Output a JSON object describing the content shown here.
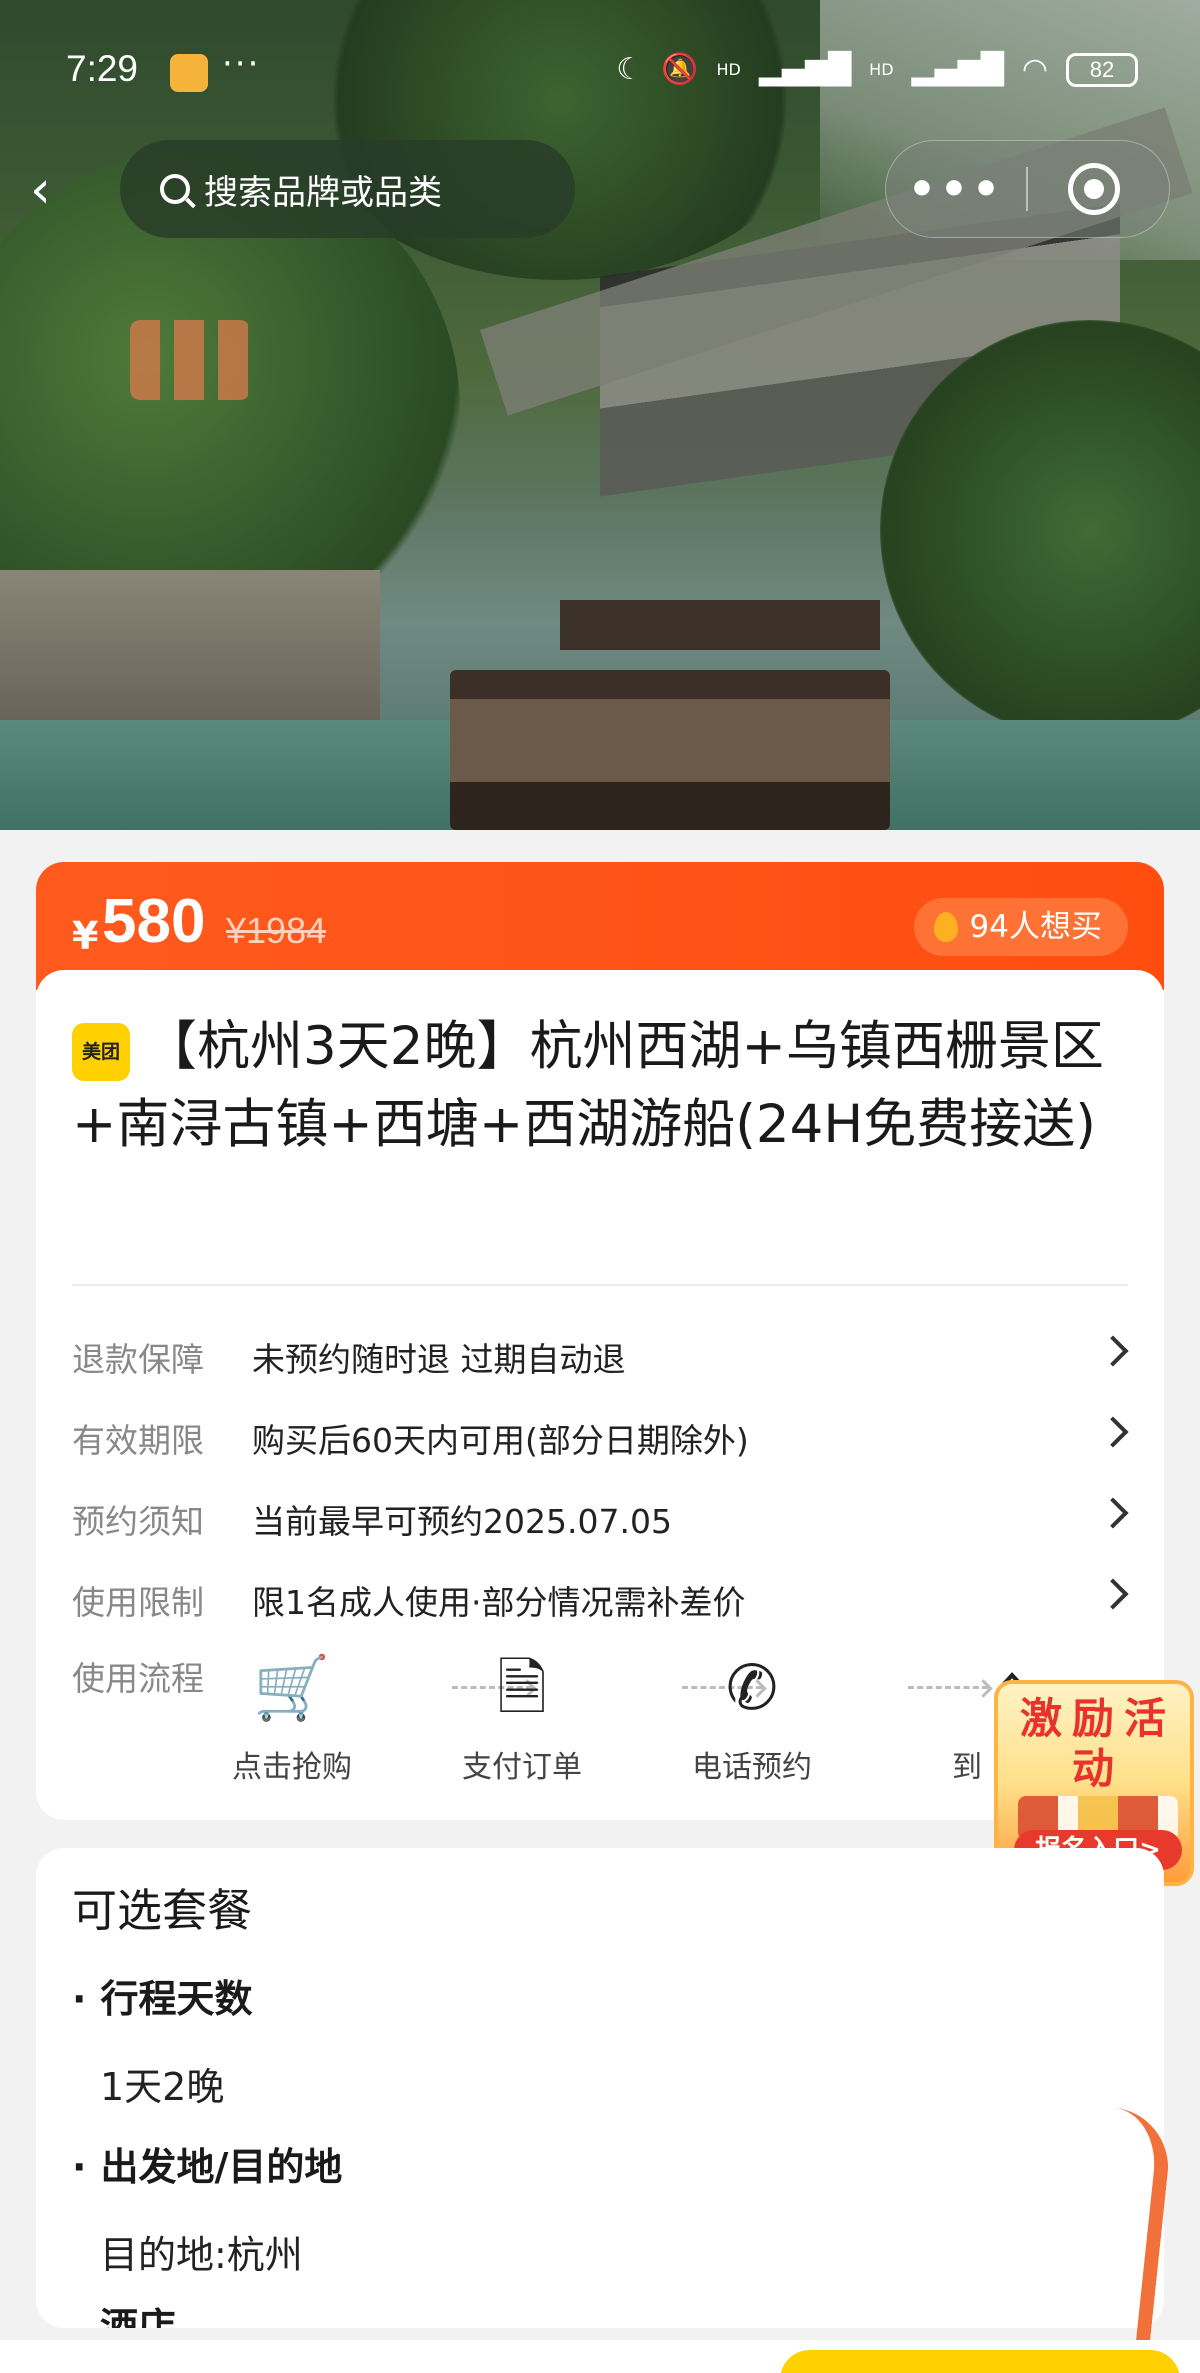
{
  "status_bar": {
    "time": "7:29",
    "battery": "82",
    "extra": "···",
    "hd1": "HD",
    "hd2": "HD"
  },
  "nav": {
    "search_placeholder": "搜索品牌或品类",
    "more": "•••"
  },
  "price": {
    "currency": "¥",
    "current": "580",
    "original": "¥1984",
    "wants": "94人想买"
  },
  "product": {
    "badge": "美团",
    "title": "【杭州3天2晚】杭州西湖+乌镇西栅景区+南浔古镇+西塘+西湖游船(24H免费接送)"
  },
  "info_rows": [
    {
      "label": "退款保障",
      "value": "未预约随时退 过期自动退"
    },
    {
      "label": "有效期限",
      "value": "购买后60天内可用(部分日期除外)"
    },
    {
      "label": "预约须知",
      "value": "当前最早可预约2025.07.05"
    },
    {
      "label": "使用限制",
      "value": "限1名成人使用·部分情况需补差价"
    }
  ],
  "flow": {
    "label": "使用流程",
    "steps": [
      {
        "icon": "cart-icon",
        "label": "点击抢购"
      },
      {
        "icon": "document-icon",
        "label": "支付订单"
      },
      {
        "icon": "phone-icon",
        "label": "电话预约"
      },
      {
        "icon": "home-icon",
        "label": "到"
      }
    ]
  },
  "promo": {
    "title": "激励活动",
    "button": "报名入口>"
  },
  "packages": {
    "heading": "可选套餐",
    "groups": [
      {
        "label": "行程天数",
        "value": "1天2晚"
      },
      {
        "label": "出发地/目的地",
        "value": "目的地:杭州"
      }
    ],
    "cut_label": "酒店"
  },
  "colors": {
    "accent": "#ff5a1e",
    "brand_yellow": "#ffd100"
  }
}
